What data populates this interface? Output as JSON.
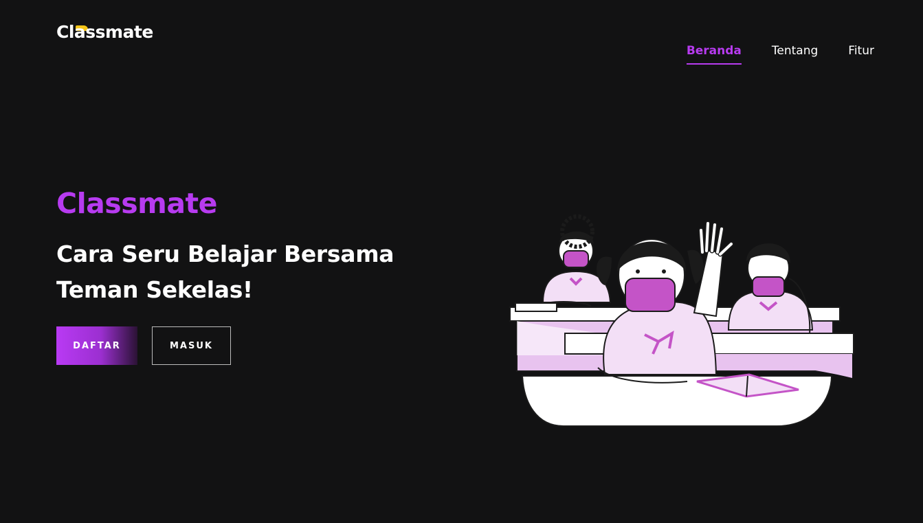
{
  "header": {
    "logo_text": "Classmate",
    "nav": [
      {
        "label": "Beranda",
        "active": true
      },
      {
        "label": "Tentang",
        "active": false
      },
      {
        "label": "Fitur",
        "active": false
      }
    ]
  },
  "hero": {
    "title": "Classmate",
    "subtitle_line1": "Cara Seru Belajar Bersama",
    "subtitle_line2": "Teman Sekelas!",
    "primary_button": "DAFTAR",
    "secondary_button": "MASUK"
  },
  "colors": {
    "background": "#121213",
    "accent": "#b73bf0",
    "logo_flag": "#f5c518",
    "illustration_pink": "#e8c3ef",
    "mask": "#c454c7"
  },
  "illustration": {
    "icon": "students-in-classroom-illustration"
  }
}
